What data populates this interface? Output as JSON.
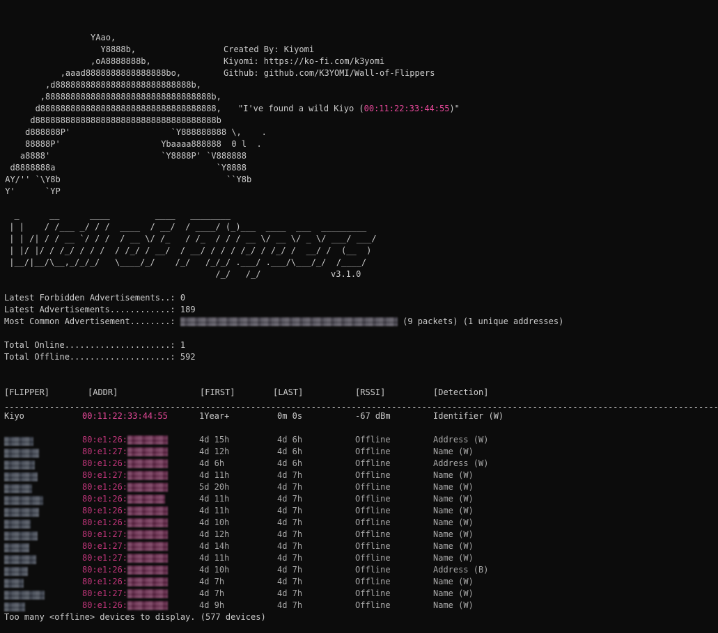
{
  "banner": {
    "ascii_art": [
      "                  YAao,",
      "                    Y8888b,",
      "                  ,oA8888888b,",
      "            ,aaad8888888888888888bo,",
      "         ,d888888888888888888888888888b,",
      "        ,888888888888888888888888888888888b,",
      "       d88888888888888888888888888888888888,",
      "      d888888888888888888888888888888888888b",
      "     d888888P'                    `Y888888888 \\,    .",
      "     88888P'                    Ybaaaa888888  0 l  .",
      "    a8888'                      `Y8888P' `V888888",
      "  d8888888a                                `Y8888",
      " AY/'' `\\Y8b                                 ``Y8b",
      " Y'      `YP"
    ],
    "created_by": "Created By: Kiyomi",
    "kiyomi_link": "Kiyomi: https://ko-fi.com/k3yomi",
    "github_link": "Github: github.com/K3YOMI/Wall-of-Flippers",
    "found_prefix": "\"I've found a wild Kiyo (",
    "found_mac": "00:11:22:33:44:55",
    "found_suffix": ")\"",
    "logo_lines": [
      "  _      __      ____         ____   ________",
      " | |    / /___ _/ / /  ____  / __/  / ____/ (_)___  ____  ___  _________",
      " | | /| / / __ `/ / /  / __ \\/ /_   / /_  / / / __ \\/ __ \\/ _ \\/ ___/ ___/",
      " | |/ |/ / /_/ / / /  / /_/ / __/  / __/ / / / /_/ / /_/ /  __/ /  (__  )",
      " |__/|__/\\__,_/_/_/   \\____/_/    /_/   /_/_/ .___/ .___/\\___/_/  /____/",
      "                                          /_/   /_/"
    ],
    "version": "v3.1.0"
  },
  "stats": {
    "forbidden_label": "Latest Forbidden Advertisements..: ",
    "forbidden_value": "0",
    "latest_label": "Latest Advertisements............: ",
    "latest_value": "189",
    "common_label": "Most Common Advertisement........: ",
    "common_suffix": " (9 packets) (1 unique addresses)",
    "online_label": "Total Online.....................: ",
    "online_value": "1",
    "offline_label": "Total Offline....................: ",
    "offline_value": "592"
  },
  "table": {
    "headers": [
      "[FLIPPER]",
      "[ADDR]",
      "[FIRST]",
      "[LAST]",
      "[RSSI]",
      "[Detection]"
    ],
    "divider": "----------------------------------------------------------------------------------------------------------------------------------------------------------------------------------------",
    "online_row": {
      "name": "Kiyo",
      "addr": "00:11:22:33:44:55",
      "first": "1Year+",
      "last": "0m 0s",
      "rssi": "-67 dBm",
      "detection": "Identifier (W)"
    },
    "offline_rows": [
      {
        "addr_prefix": "80:e1:26:",
        "first": "4d 15h",
        "last": "4d 6h",
        "rssi": "Offline",
        "detection": "Address (W)"
      },
      {
        "addr_prefix": "80:e1:27:",
        "first": "4d 12h",
        "last": "4d 6h",
        "rssi": "Offline",
        "detection": "Name (W)"
      },
      {
        "addr_prefix": "80:e1:26:",
        "first": "4d 6h",
        "last": "4d 6h",
        "rssi": "Offline",
        "detection": "Address (W)"
      },
      {
        "addr_prefix": "80:e1:27:",
        "first": "4d 11h",
        "last": "4d 7h",
        "rssi": "Offline",
        "detection": "Name (W)"
      },
      {
        "addr_prefix": "80:e1:26:",
        "first": "5d 20h",
        "last": "4d 7h",
        "rssi": "Offline",
        "detection": "Name (W)"
      },
      {
        "addr_prefix": "80:e1:26:",
        "first": "4d 11h",
        "last": "4d 7h",
        "rssi": "Offline",
        "detection": "Name (W)"
      },
      {
        "addr_prefix": "80:e1:26:",
        "first": "4d 11h",
        "last": "4d 7h",
        "rssi": "Offline",
        "detection": "Name (W)"
      },
      {
        "addr_prefix": "80:e1:26:",
        "first": "4d 10h",
        "last": "4d 7h",
        "rssi": "Offline",
        "detection": "Name (W)"
      },
      {
        "addr_prefix": "80:e1:27:",
        "first": "4d 12h",
        "last": "4d 7h",
        "rssi": "Offline",
        "detection": "Name (W)"
      },
      {
        "addr_prefix": "80:e1:27:",
        "first": "4d 14h",
        "last": "4d 7h",
        "rssi": "Offline",
        "detection": "Name (W)"
      },
      {
        "addr_prefix": "80:e1:27:",
        "first": "4d 11h",
        "last": "4d 7h",
        "rssi": "Offline",
        "detection": "Name (W)"
      },
      {
        "addr_prefix": "80:e1:26:",
        "first": "4d 10h",
        "last": "4d 7h",
        "rssi": "Offline",
        "detection": "Address (B)"
      },
      {
        "addr_prefix": "80:e1:26:",
        "first": "4d 7h",
        "last": "4d 7h",
        "rssi": "Offline",
        "detection": "Name (W)"
      },
      {
        "addr_prefix": "80:e1:27:",
        "first": "4d 7h",
        "last": "4d 7h",
        "rssi": "Offline",
        "detection": "Name (W)"
      },
      {
        "addr_prefix": "80:e1:26:",
        "first": "4d 9h",
        "last": "4d 7h",
        "rssi": "Offline",
        "detection": "Name (W)"
      }
    ]
  },
  "footer": "Too many <offline> devices to display. (577 devices)",
  "colors": {
    "background": "#0c0c0c",
    "text": "#cccccc",
    "accent_pink": "#e8489a"
  }
}
